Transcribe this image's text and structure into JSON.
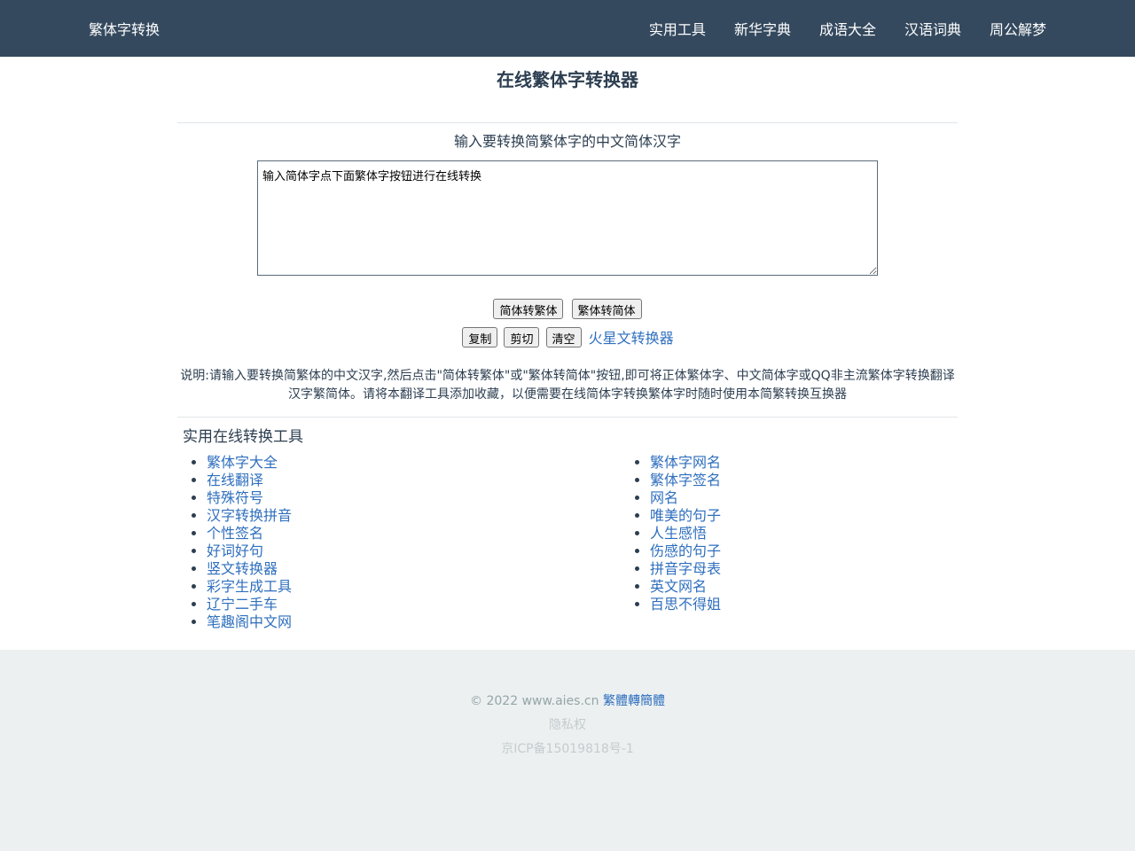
{
  "nav": {
    "brand": "繁体字转换",
    "links": [
      "实用工具",
      "新华字典",
      "成语大全",
      "汉语词典",
      "周公解梦"
    ]
  },
  "main": {
    "title": "在线繁体字转换器",
    "prompt": "输入要转换简繁体字的中文简体汉字",
    "textarea_value": "输入简体字点下面繁体字按钮进行在线转换",
    "buttons": {
      "to_traditional": "简体转繁体",
      "to_simplified": "繁体转简体",
      "copy": "复制",
      "cut": "剪切",
      "clear": "清空"
    },
    "mars_link": "火星文转换器",
    "description": "说明:请输入要转换简繁体的中文汉字,然后点击\"简体转繁体\"或\"繁体转简体\"按钮,即可将正体繁体字、中文简体字或QQ非主流繁体字转换翻译汉字繁简体。请将本翻译工具添加收藏，以便需要在线简体字转换繁体字时随时使用本简繁转换互换器"
  },
  "tools": {
    "title": "实用在线转换工具",
    "left": [
      "繁体字大全",
      "在线翻译",
      "特殊符号",
      "汉字转换拼音",
      "个性签名",
      "好词好句",
      "竖文转换器",
      "彩字生成工具",
      "辽宁二手车",
      "笔趣阁中文网"
    ],
    "right": [
      "繁体字网名",
      "繁体字签名",
      "网名",
      "唯美的句子",
      "人生感悟",
      "伤感的句子",
      "拼音字母表",
      "英文网名",
      "百思不得姐"
    ]
  },
  "footer": {
    "copyright": "© 2022 www.aies.cn",
    "copyright_link": "繁體轉簡體",
    "privacy": "隐私权",
    "icp": "京ICP备15019818号-1"
  },
  "colors": {
    "navbar": "#34495e",
    "link": "#2f6fbe",
    "footer_bg": "#ecf0f1"
  }
}
